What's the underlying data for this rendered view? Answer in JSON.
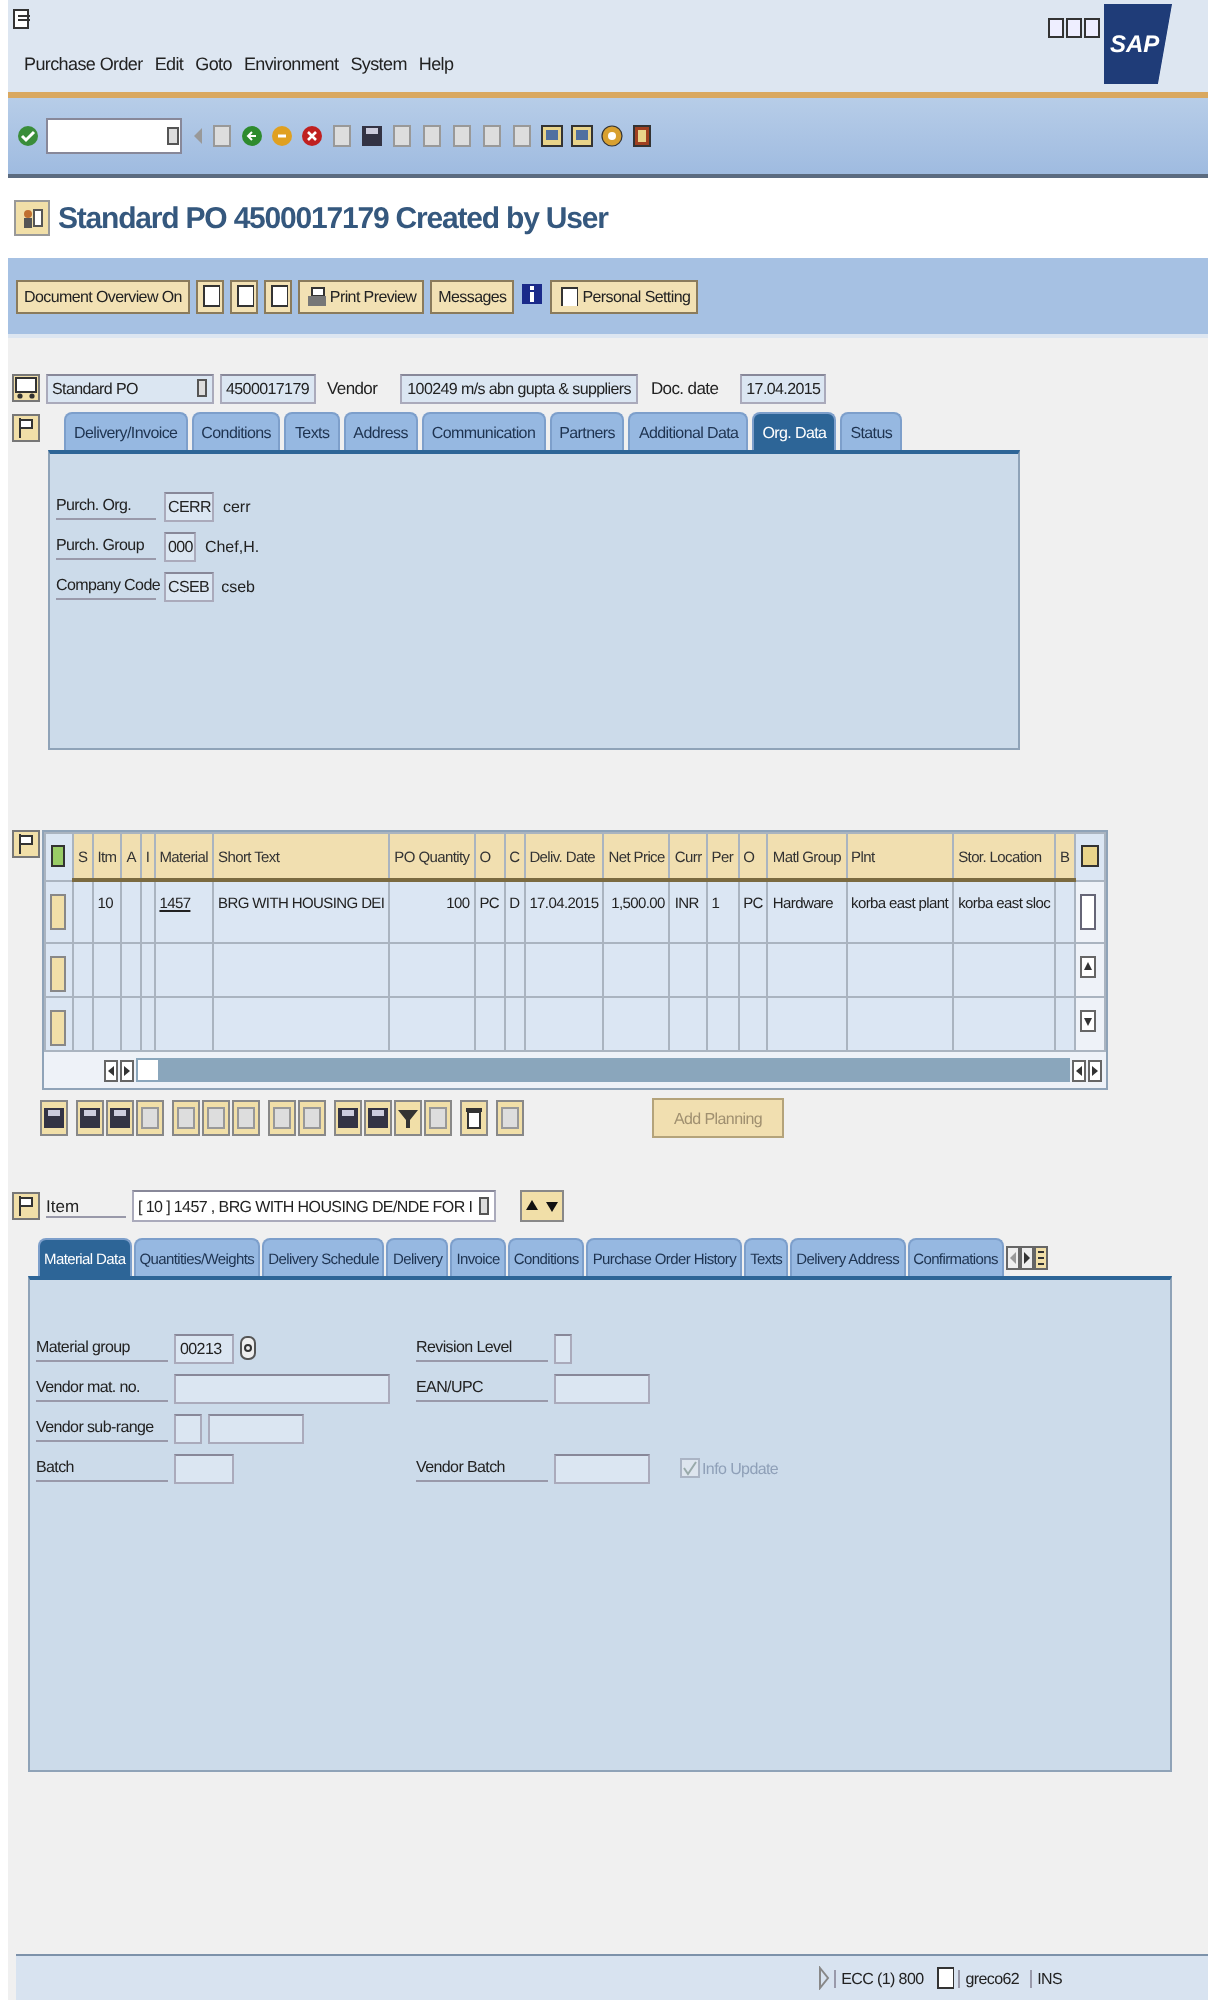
{
  "window": {
    "menu": [
      "Purchase Order",
      "Edit",
      "Goto",
      "Environment",
      "System",
      "Help"
    ],
    "logo": "SAP",
    "title": "Standard PO 4500017179 Created by User"
  },
  "app_toolbar": [
    {
      "label": "Document Overview On"
    },
    {
      "label": "Print Preview"
    },
    {
      "label": "Messages"
    },
    {
      "label": "Personal Setting"
    }
  ],
  "header": {
    "doc_type": "Standard PO",
    "po_number": "4500017179",
    "vendor_label": "Vendor",
    "vendor": "100249 m/s abn gupta & suppliers",
    "date_label": "Doc. date",
    "doc_date": "17.04.2015"
  },
  "header_tabs": [
    {
      "label": "Delivery/Invoice",
      "selected": false
    },
    {
      "label": "Conditions",
      "selected": false
    },
    {
      "label": "Texts",
      "selected": false
    },
    {
      "label": "Address",
      "selected": false
    },
    {
      "label": "Communication",
      "selected": false
    },
    {
      "label": "Partners",
      "selected": false
    },
    {
      "label": "Additional Data",
      "selected": false
    },
    {
      "label": "Org. Data",
      "selected": true
    },
    {
      "label": "Status",
      "selected": false
    }
  ],
  "org_data": [
    {
      "label": "Purch. Org.",
      "code": "CERR",
      "description": "cerr"
    },
    {
      "label": "Purch. Group",
      "code": "000",
      "description": "Chef,H."
    },
    {
      "label": "Company Code",
      "code": "CSEB",
      "description": "cseb"
    }
  ],
  "items_table": {
    "columns": [
      {
        "label": "S",
        "kind": "text"
      },
      {
        "label": "Itm",
        "kind": "text"
      },
      {
        "label": "A",
        "kind": "text"
      },
      {
        "label": "I",
        "kind": "text"
      },
      {
        "label": "Material",
        "kind": "link"
      },
      {
        "label": "Short Text",
        "kind": "text"
      },
      {
        "label": "PO Quantity",
        "kind": "number"
      },
      {
        "label": "O",
        "kind": "text"
      },
      {
        "label": "C",
        "kind": "text"
      },
      {
        "label": "Deliv. Date",
        "kind": "text"
      },
      {
        "label": "Net Price",
        "kind": "number"
      },
      {
        "label": "Curr",
        "kind": "text"
      },
      {
        "label": "Per",
        "kind": "text"
      },
      {
        "label": "O",
        "kind": "text"
      },
      {
        "label": "Matl Group",
        "kind": "text"
      },
      {
        "label": "Plnt",
        "kind": "text"
      },
      {
        "label": "Stor. Location",
        "kind": "text"
      },
      {
        "label": "B",
        "kind": "text"
      }
    ],
    "rows": [
      {
        "item": "10",
        "material": "1457",
        "short_text": "BRG WITH HOUSING DEI",
        "quantity": "100",
        "unit": "PC",
        "date_cat": "D",
        "delivery_date": "17.04.2015",
        "net_price": "1,500.00",
        "currency": "INR",
        "per": "1",
        "price_unit": "PC",
        "matl_group": "Hardware",
        "plant": "korba east plant",
        "storage": "korba east sloc"
      }
    ]
  },
  "add_planning": {
    "label": "Add Planning",
    "disabled": true
  },
  "item_selector": {
    "label": "Item",
    "value": "[ 10 ] 1457 , BRG WITH HOUSING DE/NDE FOR I"
  },
  "item_tabs": [
    {
      "label": "Material Data",
      "selected": true
    },
    {
      "label": "Quantities/Weights",
      "selected": false
    },
    {
      "label": "Delivery Schedule",
      "selected": false
    },
    {
      "label": "Delivery",
      "selected": false
    },
    {
      "label": "Invoice",
      "selected": false
    },
    {
      "label": "Conditions",
      "selected": false
    },
    {
      "label": "Purchase Order History",
      "selected": false
    },
    {
      "label": "Texts",
      "selected": false
    },
    {
      "label": "Delivery Address",
      "selected": false
    },
    {
      "label": "Confirmations",
      "selected": false
    }
  ],
  "material_data": {
    "material_group": {
      "label": "Material group",
      "value": "00213"
    },
    "revision_level": {
      "label": "Revision Level"
    },
    "vendor_mat_no": {
      "label": "Vendor mat. no."
    },
    "ean_upc": {
      "label": "EAN/UPC"
    },
    "vendor_sub_range": {
      "label": "Vendor sub-range"
    },
    "batch": {
      "label": "Batch"
    },
    "vendor_batch": {
      "label": "Vendor Batch"
    },
    "info_update": {
      "label": "Info Update",
      "checked": true,
      "disabled": true
    }
  },
  "status_bar": {
    "system": "ECC (1) 800",
    "user": "greco62",
    "mode": "INS"
  }
}
